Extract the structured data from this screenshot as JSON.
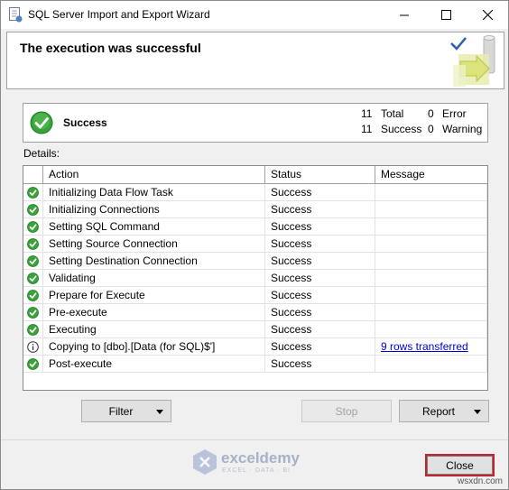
{
  "window": {
    "title": "SQL Server Import and Export Wizard",
    "controls": [
      "minimize-icon",
      "maximize-icon",
      "close-icon"
    ]
  },
  "header": {
    "title": "The execution was successful"
  },
  "summary": {
    "status_label": "Success",
    "total_count": "11",
    "total_label": "Total",
    "success_count": "11",
    "success_label": "Success",
    "error_count": "0",
    "error_label": "Error",
    "warning_count": "0",
    "warning_label": "Warning"
  },
  "details": {
    "label": "Details:",
    "columns": [
      "Action",
      "Status",
      "Message"
    ],
    "rows": [
      {
        "icon": "success-icon",
        "action": "Initializing Data Flow Task",
        "status": "Success",
        "message": ""
      },
      {
        "icon": "success-icon",
        "action": "Initializing Connections",
        "status": "Success",
        "message": ""
      },
      {
        "icon": "success-icon",
        "action": "Setting SQL Command",
        "status": "Success",
        "message": ""
      },
      {
        "icon": "success-icon",
        "action": "Setting Source Connection",
        "status": "Success",
        "message": ""
      },
      {
        "icon": "success-icon",
        "action": "Setting Destination Connection",
        "status": "Success",
        "message": ""
      },
      {
        "icon": "success-icon",
        "action": "Validating",
        "status": "Success",
        "message": ""
      },
      {
        "icon": "success-icon",
        "action": "Prepare for Execute",
        "status": "Success",
        "message": ""
      },
      {
        "icon": "success-icon",
        "action": "Pre-execute",
        "status": "Success",
        "message": ""
      },
      {
        "icon": "success-icon",
        "action": "Executing",
        "status": "Success",
        "message": ""
      },
      {
        "icon": "info-icon",
        "action": "Copying to [dbo].[Data (for SQL)$']",
        "status": "Success",
        "message": "9 rows transferred"
      },
      {
        "icon": "success-icon",
        "action": "Post-execute",
        "status": "Success",
        "message": ""
      }
    ]
  },
  "buttons": {
    "filter": "Filter",
    "stop": "Stop",
    "report": "Report",
    "close": "Close"
  },
  "watermark": {
    "name": "exceldemy",
    "tagline": "EXCEL · DATA · BI"
  },
  "site_mark": "wsxdn.com",
  "colors": {
    "success_green": "#3aa23a",
    "link_blue": "#0000cc",
    "close_highlight": "#c0242c"
  }
}
